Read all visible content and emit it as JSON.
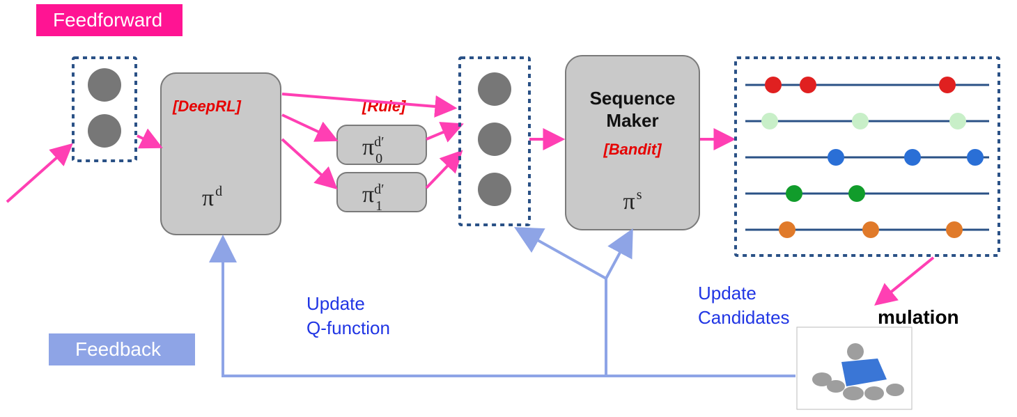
{
  "tags": {
    "feedforward": "Feedforward",
    "feedback": "Feedback"
  },
  "deeprl_box": {
    "method": "[DeepRL]",
    "policy": "π",
    "sup": "d"
  },
  "rule_boxes": {
    "label": "[Rule]",
    "p0": "π",
    "p0_sub": "0",
    "p0_sup": "d′",
    "p1": "π",
    "p1_sub": "1",
    "p1_sup": "d′"
  },
  "seq_box": {
    "line1": "Sequence",
    "line2": "Maker",
    "method": "[Bandit]",
    "policy": "π",
    "sup": "s"
  },
  "feedback": {
    "q": "Update",
    "q2": "Q-function",
    "c": "Update",
    "c2": "Candidates"
  },
  "simulation": "mulation",
  "colors": {
    "row1": "#e02020",
    "row2": "#c8efc8",
    "row3": "#2a6fd6",
    "row4": "#119c2b",
    "row5": "#e07a2a"
  }
}
